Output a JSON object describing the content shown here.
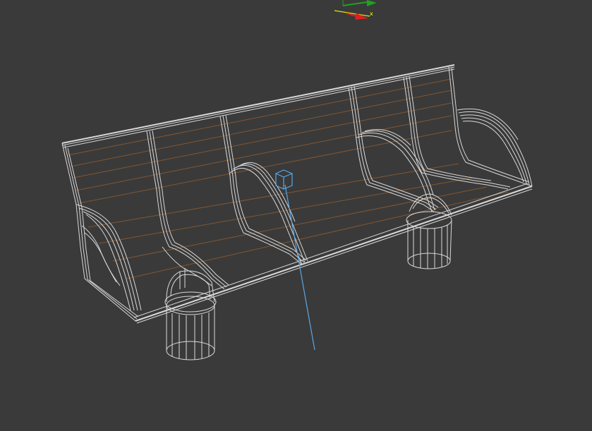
{
  "viewport": {
    "background": "#3a3a3a",
    "wire_color": "#d9d9d9",
    "rail_color": "#8a5a32",
    "pivot_color": "#5aa7e6"
  },
  "gizmo": {
    "x_label": "x",
    "x_color": "#e02020",
    "y_color": "#1fa21f",
    "z_color": "#e6e600"
  },
  "model": {
    "name": "bench-wireframe",
    "icon": "mesh-icon"
  }
}
